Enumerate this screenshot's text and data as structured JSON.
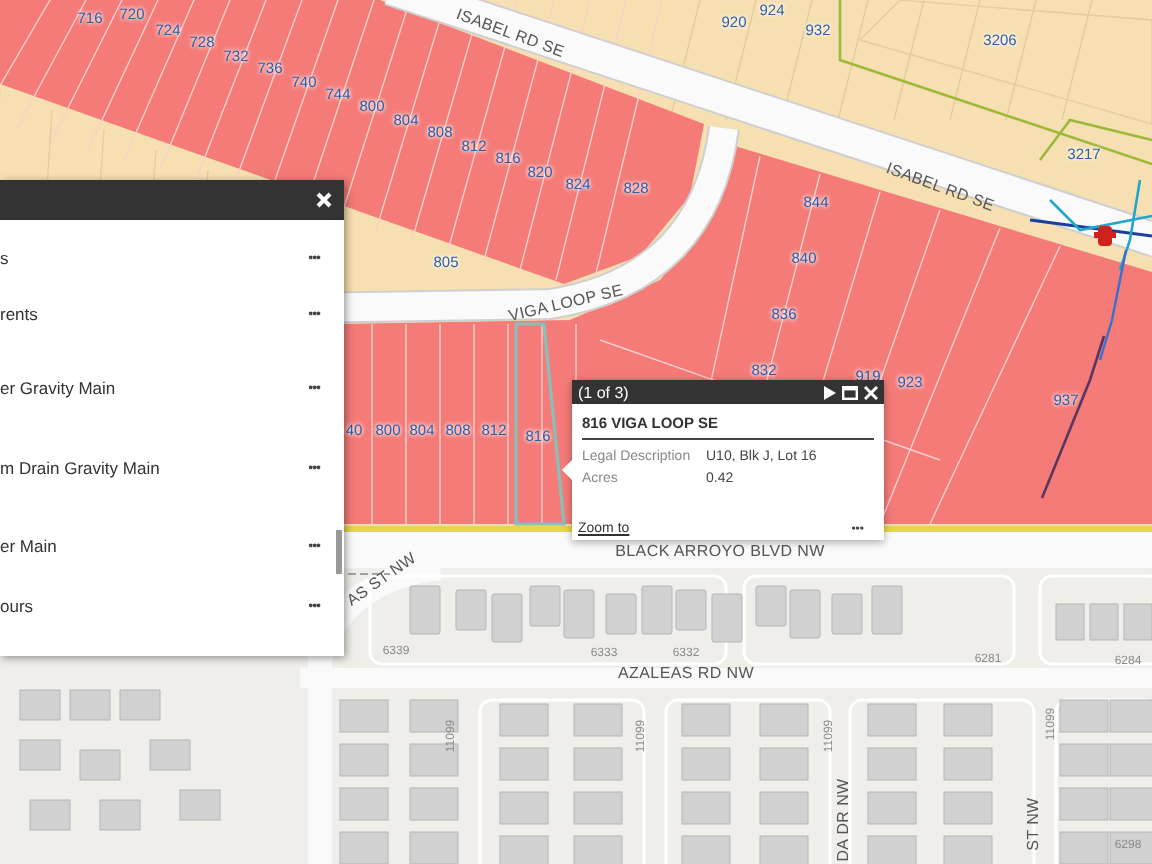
{
  "map": {
    "labels": [
      {
        "kind": "parcel",
        "text": "716"
      },
      {
        "kind": "parcel",
        "text": "720"
      },
      {
        "kind": "parcel",
        "text": "724"
      },
      {
        "kind": "parcel",
        "text": "728"
      },
      {
        "kind": "parcel",
        "text": "732"
      },
      {
        "kind": "parcel",
        "text": "736"
      },
      {
        "kind": "parcel",
        "text": "740"
      },
      {
        "kind": "parcel",
        "text": "744"
      },
      {
        "kind": "parcel",
        "text": "800"
      },
      {
        "kind": "parcel",
        "text": "804"
      },
      {
        "kind": "parcel",
        "text": "808"
      },
      {
        "kind": "parcel",
        "text": "812"
      },
      {
        "kind": "parcel",
        "text": "816"
      },
      {
        "kind": "parcel",
        "text": "820"
      },
      {
        "kind": "parcel",
        "text": "824"
      },
      {
        "kind": "parcel",
        "text": "828"
      },
      {
        "kind": "parcel",
        "text": "920"
      },
      {
        "kind": "parcel",
        "text": "924"
      },
      {
        "kind": "parcel",
        "text": "932"
      },
      {
        "kind": "parcel",
        "text": "3206"
      },
      {
        "kind": "parcel",
        "text": "3217"
      },
      {
        "kind": "parcel",
        "text": "844"
      },
      {
        "kind": "parcel",
        "text": "840"
      },
      {
        "kind": "parcel",
        "text": "805"
      },
      {
        "kind": "parcel",
        "text": "836"
      },
      {
        "kind": "parcel",
        "text": "832"
      },
      {
        "kind": "parcel",
        "text": "919"
      },
      {
        "kind": "parcel",
        "text": "923"
      },
      {
        "kind": "parcel",
        "text": "937"
      },
      {
        "kind": "parcel",
        "text": "40"
      },
      {
        "kind": "parcel",
        "text": "800"
      },
      {
        "kind": "parcel",
        "text": "804"
      },
      {
        "kind": "parcel",
        "text": "808"
      },
      {
        "kind": "parcel",
        "text": "812"
      },
      {
        "kind": "parcel",
        "text": "816"
      },
      {
        "kind": "street",
        "text": "ISABEL RD SE"
      },
      {
        "kind": "street",
        "text": "ISABEL RD SE"
      },
      {
        "kind": "street",
        "text": "VIGA LOOP SE"
      },
      {
        "kind": "street",
        "text": "BLACK ARROYO BLVD NW"
      },
      {
        "kind": "street",
        "text": "AS ST NW"
      },
      {
        "kind": "street",
        "text": "AZALEAS RD NW"
      },
      {
        "kind": "street",
        "text": "DA DR NW"
      },
      {
        "kind": "street",
        "text": "ST NW"
      },
      {
        "kind": "address",
        "text": "6339"
      },
      {
        "kind": "address",
        "text": "6333"
      },
      {
        "kind": "address",
        "text": "6332"
      },
      {
        "kind": "address",
        "text": "6281"
      },
      {
        "kind": "address",
        "text": "6284"
      },
      {
        "kind": "address",
        "text": "6298"
      },
      {
        "kind": "address",
        "text": "11099"
      },
      {
        "kind": "address",
        "text": "11099"
      },
      {
        "kind": "address",
        "text": "11099"
      },
      {
        "kind": "address",
        "text": "11099"
      }
    ]
  },
  "layer_panel": {
    "items": [
      {
        "label": "s",
        "menu": "•••"
      },
      {
        "label": "rents",
        "menu": "•••"
      },
      {
        "label": "er Gravity Main",
        "menu": "•••"
      },
      {
        "label": "m Drain Gravity Main",
        "menu": "•••"
      },
      {
        "label": "er Main",
        "menu": "•••"
      },
      {
        "label": "ours",
        "menu": "•••"
      }
    ]
  },
  "popup": {
    "counter": "(1 of 3)",
    "title": "816 VIGA LOOP SE",
    "fields": [
      {
        "name": "Legal Description",
        "value": "U10, Blk J, Lot 16"
      },
      {
        "name": "Acres",
        "value": "0.42"
      }
    ],
    "link": "Zoom to",
    "menu": "•••"
  }
}
